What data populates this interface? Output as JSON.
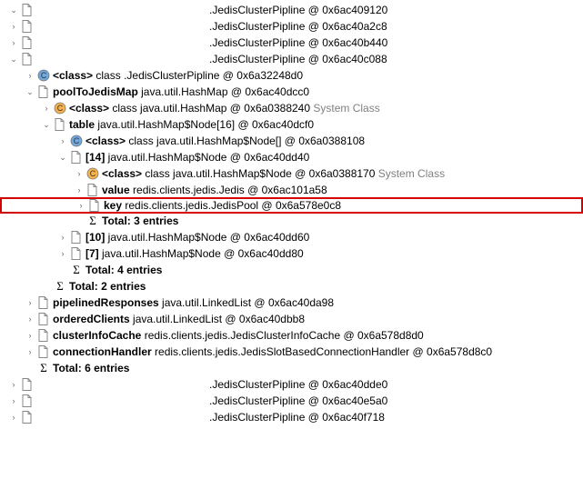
{
  "rows": [
    {
      "indent": 0,
      "toggle": "open",
      "icon": "file",
      "pad": true,
      "segs": [
        {
          "t": ".JedisClusterPipline @ 0x6ac409120"
        }
      ]
    },
    {
      "indent": 0,
      "toggle": "closed",
      "icon": "file",
      "pad": true,
      "segs": [
        {
          "t": ".JedisClusterPipline @ 0x6ac40a2c8"
        }
      ]
    },
    {
      "indent": 0,
      "toggle": "closed",
      "icon": "file",
      "pad": true,
      "segs": [
        {
          "t": ".JedisClusterPipline @ 0x6ac40b440"
        }
      ]
    },
    {
      "indent": 0,
      "toggle": "open",
      "icon": "file",
      "pad": true,
      "segs": [
        {
          "t": ".JedisClusterPipline @ 0x6ac40c088"
        }
      ]
    },
    {
      "indent": 1,
      "toggle": "closed",
      "icon": "class",
      "segs": [
        {
          "t": "<class>",
          "bold": true
        },
        {
          "t": " class "
        },
        {
          "t": "                                         .JedisClusterPipline @ 0x6a32248d0"
        }
      ]
    },
    {
      "indent": 1,
      "toggle": "open",
      "icon": "file",
      "segs": [
        {
          "t": "poolToJedisMap",
          "bold": true
        },
        {
          "t": " java.util.HashMap @ 0x6ac40dcc0"
        }
      ]
    },
    {
      "indent": 2,
      "toggle": "closed",
      "icon": "class-s",
      "segs": [
        {
          "t": "<class>",
          "bold": true
        },
        {
          "t": " class java.util.HashMap @ 0x6a0388240 "
        },
        {
          "t": "System Class",
          "gray": true
        }
      ]
    },
    {
      "indent": 2,
      "toggle": "open",
      "icon": "file",
      "segs": [
        {
          "t": "table",
          "bold": true
        },
        {
          "t": " java.util.HashMap$Node[16] @ 0x6ac40dcf0"
        }
      ]
    },
    {
      "indent": 3,
      "toggle": "closed",
      "icon": "class",
      "segs": [
        {
          "t": "<class>",
          "bold": true
        },
        {
          "t": " class java.util.HashMap$Node[] @ 0x6a0388108"
        }
      ]
    },
    {
      "indent": 3,
      "toggle": "open",
      "icon": "file",
      "segs": [
        {
          "t": "[14]",
          "bold": true
        },
        {
          "t": " java.util.HashMap$Node @ 0x6ac40dd40"
        }
      ]
    },
    {
      "indent": 4,
      "toggle": "closed",
      "icon": "class-s",
      "segs": [
        {
          "t": "<class>",
          "bold": true
        },
        {
          "t": " class java.util.HashMap$Node @ 0x6a0388170 "
        },
        {
          "t": "System Class",
          "gray": true
        }
      ]
    },
    {
      "indent": 4,
      "toggle": "closed",
      "icon": "file",
      "segs": [
        {
          "t": "value",
          "bold": true
        },
        {
          "t": " redis.clients.jedis.Jedis @ 0x6ac101a58"
        }
      ]
    },
    {
      "indent": 4,
      "toggle": "closed",
      "icon": "file",
      "hl": true,
      "segs": [
        {
          "t": "key",
          "bold": true
        },
        {
          "t": " redis.clients.jedis.JedisPool @ 0x6a578e0c8"
        }
      ]
    },
    {
      "indent": 4,
      "toggle": "none",
      "icon": "sigma",
      "segs": [
        {
          "t": "Total: 3 entries",
          "bold": true
        }
      ]
    },
    {
      "indent": 3,
      "toggle": "closed",
      "icon": "file",
      "segs": [
        {
          "t": "[10]",
          "bold": true
        },
        {
          "t": " java.util.HashMap$Node @ 0x6ac40dd60"
        }
      ]
    },
    {
      "indent": 3,
      "toggle": "closed",
      "icon": "file",
      "segs": [
        {
          "t": "[7]",
          "bold": true
        },
        {
          "t": " java.util.HashMap$Node @ 0x6ac40dd80"
        }
      ]
    },
    {
      "indent": 3,
      "toggle": "none",
      "icon": "sigma",
      "segs": [
        {
          "t": "Total: 4 entries",
          "bold": true
        }
      ]
    },
    {
      "indent": 2,
      "toggle": "none",
      "icon": "sigma",
      "segs": [
        {
          "t": "Total: 2 entries",
          "bold": true
        }
      ]
    },
    {
      "indent": 1,
      "toggle": "closed",
      "icon": "file",
      "segs": [
        {
          "t": "pipelinedResponses",
          "bold": true
        },
        {
          "t": " java.util.LinkedList @ 0x6ac40da98"
        }
      ]
    },
    {
      "indent": 1,
      "toggle": "closed",
      "icon": "file",
      "segs": [
        {
          "t": "orderedClients",
          "bold": true
        },
        {
          "t": " java.util.LinkedList @ 0x6ac40dbb8"
        }
      ]
    },
    {
      "indent": 1,
      "toggle": "closed",
      "icon": "file",
      "segs": [
        {
          "t": "clusterInfoCache",
          "bold": true
        },
        {
          "t": " redis.clients.jedis.JedisClusterInfoCache @ 0x6a578d8d0"
        }
      ]
    },
    {
      "indent": 1,
      "toggle": "closed",
      "icon": "file",
      "segs": [
        {
          "t": "connectionHandler",
          "bold": true
        },
        {
          "t": " redis.clients.jedis.JedisSlotBasedConnectionHandler @ 0x6a578d8c0"
        }
      ]
    },
    {
      "indent": 1,
      "toggle": "none",
      "icon": "sigma",
      "segs": [
        {
          "t": "Total: 6 entries",
          "bold": true
        }
      ]
    },
    {
      "indent": 0,
      "toggle": "closed",
      "icon": "file",
      "pad": true,
      "segs": [
        {
          "t": ".JedisClusterPipline @ 0x6ac40dde0"
        }
      ]
    },
    {
      "indent": 0,
      "toggle": "closed",
      "icon": "file",
      "pad": true,
      "segs": [
        {
          "t": ".JedisClusterPipline @ 0x6ac40e5a0"
        }
      ]
    },
    {
      "indent": 0,
      "toggle": "closed",
      "icon": "file",
      "pad": true,
      "segs": [
        {
          "t": ".JedisClusterPipline @ 0x6ac40f718"
        }
      ]
    }
  ]
}
